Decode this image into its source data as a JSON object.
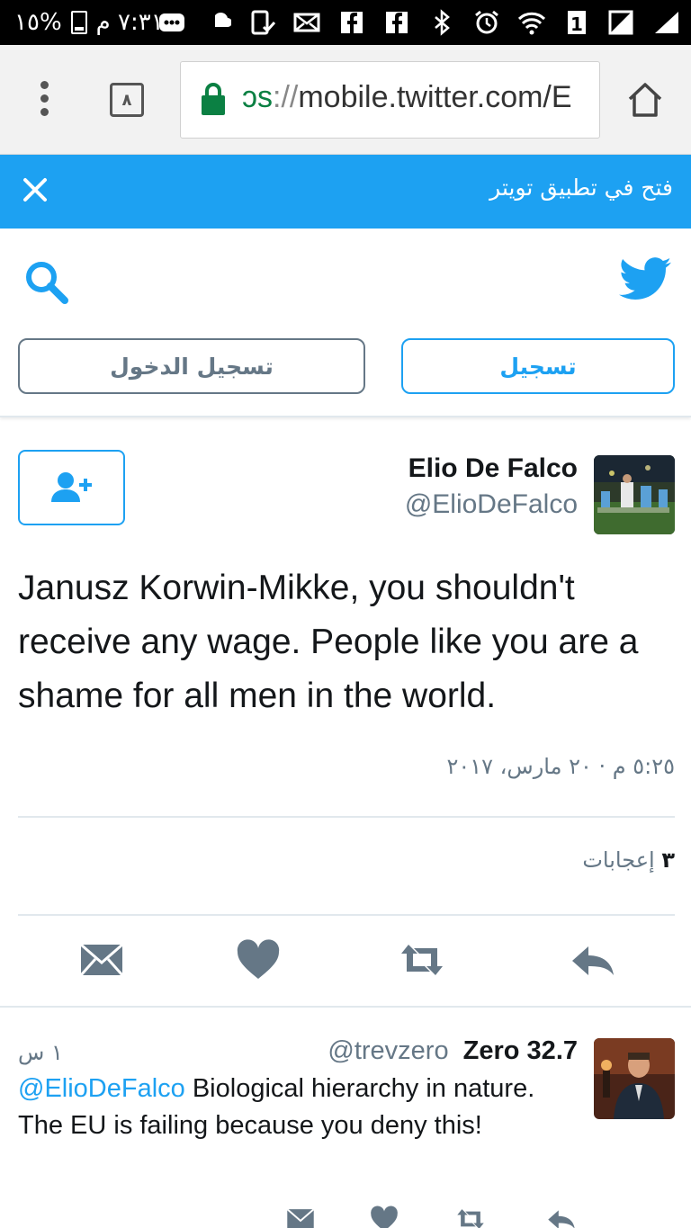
{
  "status_bar": {
    "time": "٧:٣١ م",
    "battery": "%١٥",
    "icons": [
      "battery-icon",
      "signal-icon",
      "no-sim-icon",
      "sim-1-icon",
      "wifi-icon",
      "alarm-icon",
      "bluetooth-icon",
      "facebook-icon",
      "facebook-icon",
      "mail-icon",
      "phone-check-icon",
      "soundcloud-icon",
      "more-icon"
    ]
  },
  "browser": {
    "tab_count": "٨",
    "url_scheme": "ɔs",
    "url_sep": "://",
    "url_host": "mobile.twitter.com/E"
  },
  "banner": {
    "open_in_app": "فتح في تطبيق تويتر"
  },
  "header": {
    "login_label": "تسجيل الدخول",
    "signup_label": "تسجيل"
  },
  "tweet": {
    "name": "Elio De Falco",
    "handle": "@ElioDeFalco",
    "text": "Janusz Korwin-Mikke, you shouldn't receive any wage. People like you are a shame for all men in the world.",
    "timestamp": "٥:٢٥ م · ٢٠ مارس، ٢٠١٧",
    "likes_count": "٣",
    "likes_label": "إعجابات"
  },
  "reply": {
    "name": "Zero 32.7",
    "handle": "@trevzero",
    "time": "١ س",
    "mention": "@ElioDeFalco",
    "text": " Biological hierarchy in nature. The EU is failing because you deny this!"
  },
  "colors": {
    "brand": "#1da1f2",
    "secure": "#0b8043",
    "muted": "#657786",
    "action_icon": "#657786"
  }
}
